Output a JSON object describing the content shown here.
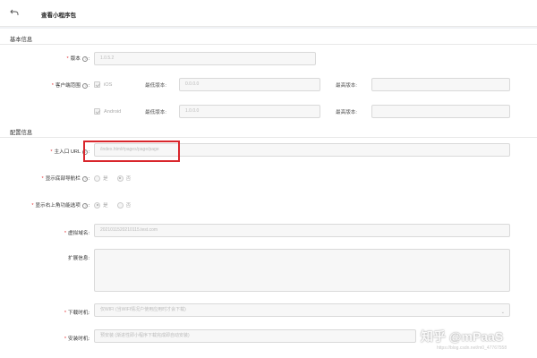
{
  "header": {
    "title": "查看小程序包",
    "back_icon": "back-arrow-icon"
  },
  "sections": {
    "basic": "基本信息",
    "config": "配置信息"
  },
  "fields": {
    "version": {
      "label": "版本",
      "value": "1.0.5.2"
    },
    "client_range": {
      "label": "客户端范围",
      "ios": "iOS",
      "android": "Android"
    },
    "min_version_label": "最低版本:",
    "max_version_label": "最高版本:",
    "ios_min": "0.0.0.0",
    "ios_max": "",
    "android_min": "1.0.0.0",
    "android_max": "",
    "main_url": {
      "label": "主入口 URL",
      "value": "/index.html#pages/page/page"
    },
    "bottom_nav": {
      "label": "显示底部导航栏",
      "yes": "是",
      "no": "否"
    },
    "top_right": {
      "label": "显示右上角功能选项",
      "yes": "是",
      "no": "否"
    },
    "virtual_domain": {
      "label": "虚拟域名",
      "value": "20210115202101​15.test.com"
    },
    "ext_info": {
      "label": "扩展信息",
      "value": ""
    },
    "download_time": {
      "label": "下载时机",
      "value": "仅WIFI (当WIFI情况户使用应用时才会下载)"
    },
    "install_time": {
      "label": "安装时机",
      "value": "预安装 (渐进性即小程序下载完成即自动安装)"
    }
  },
  "watermark": {
    "text": "知乎 @mPaaS",
    "sub": "https://blog.csdn.net/m0_47767558"
  }
}
